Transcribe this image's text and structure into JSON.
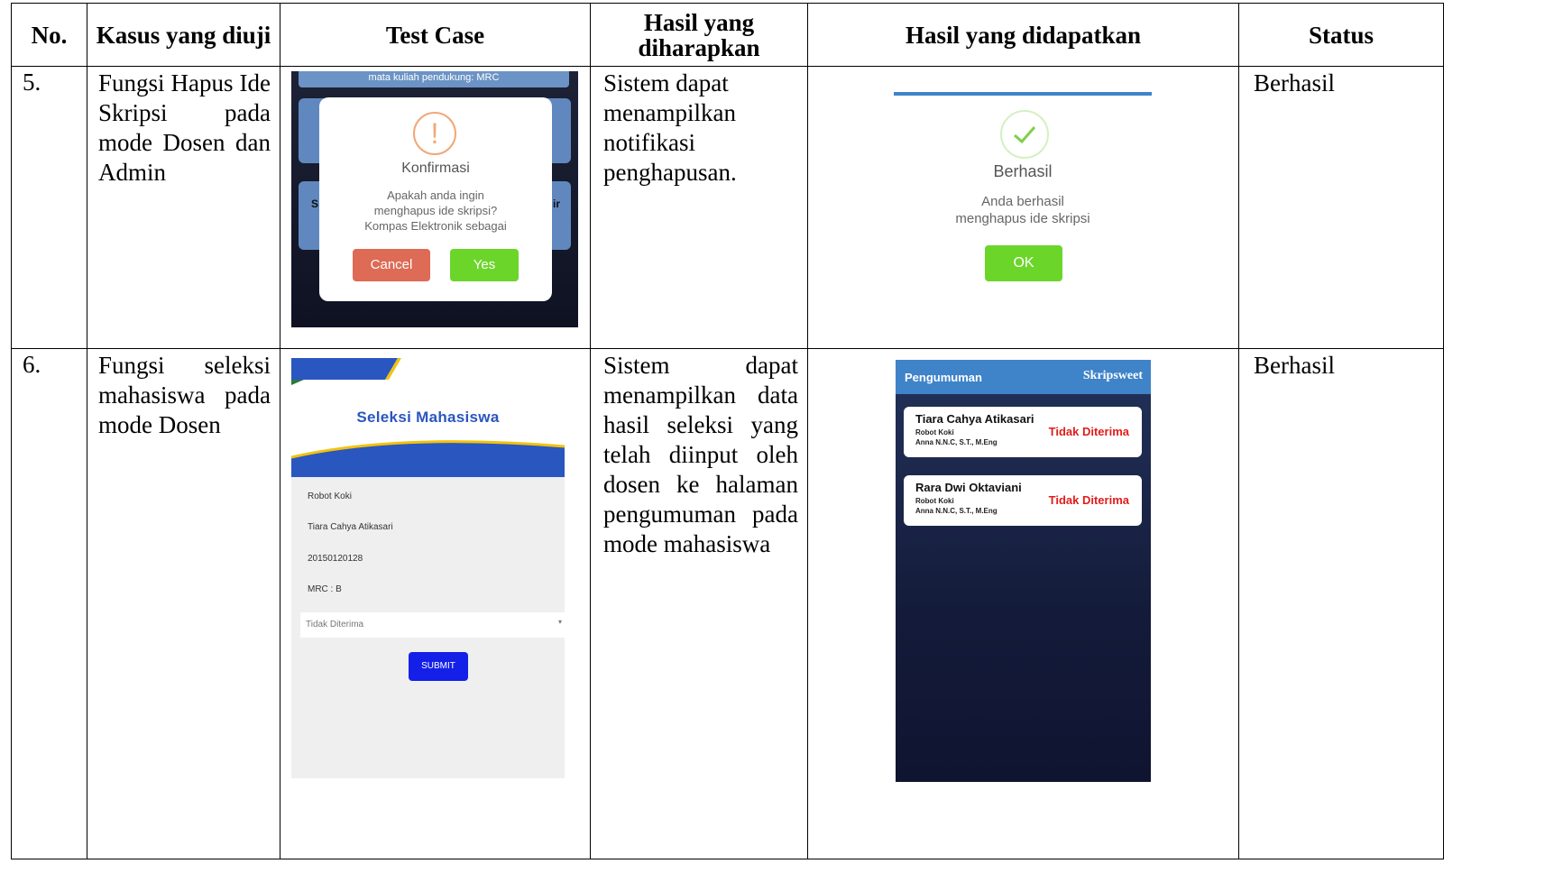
{
  "table": {
    "headers": {
      "no": "No.",
      "kasus": "Kasus yang diuji",
      "test_case": "Test Case",
      "hasil_diharapkan": "Hasil yang diharapkan",
      "hasil_didapatkan": "Hasil yang didapatkan",
      "status": "Status"
    },
    "rows": [
      {
        "no": "5.",
        "kasus": "Fungsi Hapus Ide Skripsi pada mode Dosen dan Admin",
        "hasil_diharapkan": "Sistem dapat menampilkan notifikasi penghapusan.",
        "status": "Berhasil"
      },
      {
        "no": "6.",
        "kasus": "Fungsi seleksi mahasiswa pada mode Dosen",
        "hasil_diharapkan": "Sistem dapat menampilkan data hasil seleksi yang telah diinput oleh dosen ke halaman pengumuman pada mode mahasiswa",
        "status": "Berhasil"
      }
    ]
  },
  "screens": {
    "row5_test": {
      "top_text": "mata kuliah pendukung: MRC",
      "side_left": "S",
      "side_right": "ir",
      "dialog_title": "Konfirmasi",
      "dialog_message": "Apakah anda ingin menghapus ide skripsi? Kompas Elektronik sebagai",
      "cancel_label": "Cancel",
      "yes_label": "Yes",
      "icon": "warning-icon"
    },
    "row5_result": {
      "title": "Berhasil",
      "message": "Anda berhasil menghapus ide skripsi",
      "ok_label": "OK",
      "icon": "check-icon"
    },
    "row6_test": {
      "title": "Seleksi Mahasiswa",
      "fields": [
        "Robot Koki",
        "Tiara Cahya Atikasari",
        "20150120128",
        "MRC : B"
      ],
      "dropdown_value": "Tidak Diterima",
      "submit_label": "SUBMIT"
    },
    "row6_result": {
      "header_title": "Pengumuman",
      "brand": "Skripsweet",
      "cards": [
        {
          "name": "Tiara Cahya Atikasari",
          "topic": "Robot Koki",
          "lecturer": "Anna N.N.C, S.T., M.Eng",
          "status": "Tidak Diterima"
        },
        {
          "name": "Rara Dwi Oktaviani",
          "topic": "Robot Koki",
          "lecturer": "Anna N.N.C, S.T., M.Eng",
          "status": "Tidak Diterima"
        }
      ]
    }
  },
  "colors": {
    "warning": "#f0a878",
    "success_green": "#6cd52a",
    "cancel_red": "#dd6b55",
    "brand_blue": "#2a56c0",
    "status_red": "#e21c1c"
  }
}
